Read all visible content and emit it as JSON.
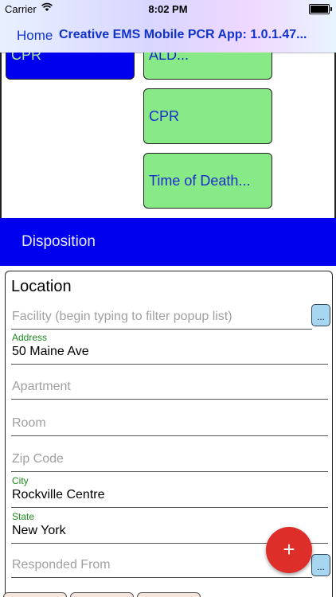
{
  "status": {
    "carrier": "Carrier",
    "time": "8:02 PM"
  },
  "nav": {
    "home": "Home",
    "title": "Creative EMS Mobile PCR App: 1.0.1.47..."
  },
  "tiles": [
    {
      "label": "CPR",
      "color": "#0000ee"
    },
    {
      "label": "ALD...",
      "color": "#88ea87"
    },
    {
      "label": "CPR",
      "color": "#88ea87"
    },
    {
      "label": "Time of Death...",
      "color": "#88ea87"
    }
  ],
  "disposition": {
    "label": "Disposition",
    "color": "#0000ee"
  },
  "location": {
    "title": "Location",
    "facility_placeholder": "Facility (begin typing to filter popup list)",
    "address_label": "Address",
    "address_value": "50 Maine Ave",
    "apartment_placeholder": "Apartment",
    "room_placeholder": "Room",
    "zip_placeholder": "Zip Code",
    "city_label": "City",
    "city_value": "Rockville Centre",
    "state_label": "State",
    "state_value": "New York",
    "responded_placeholder": "Responded From"
  },
  "buttons": {
    "picker": "...",
    "fab": "+",
    "fab_color": "#dd2e2a"
  }
}
